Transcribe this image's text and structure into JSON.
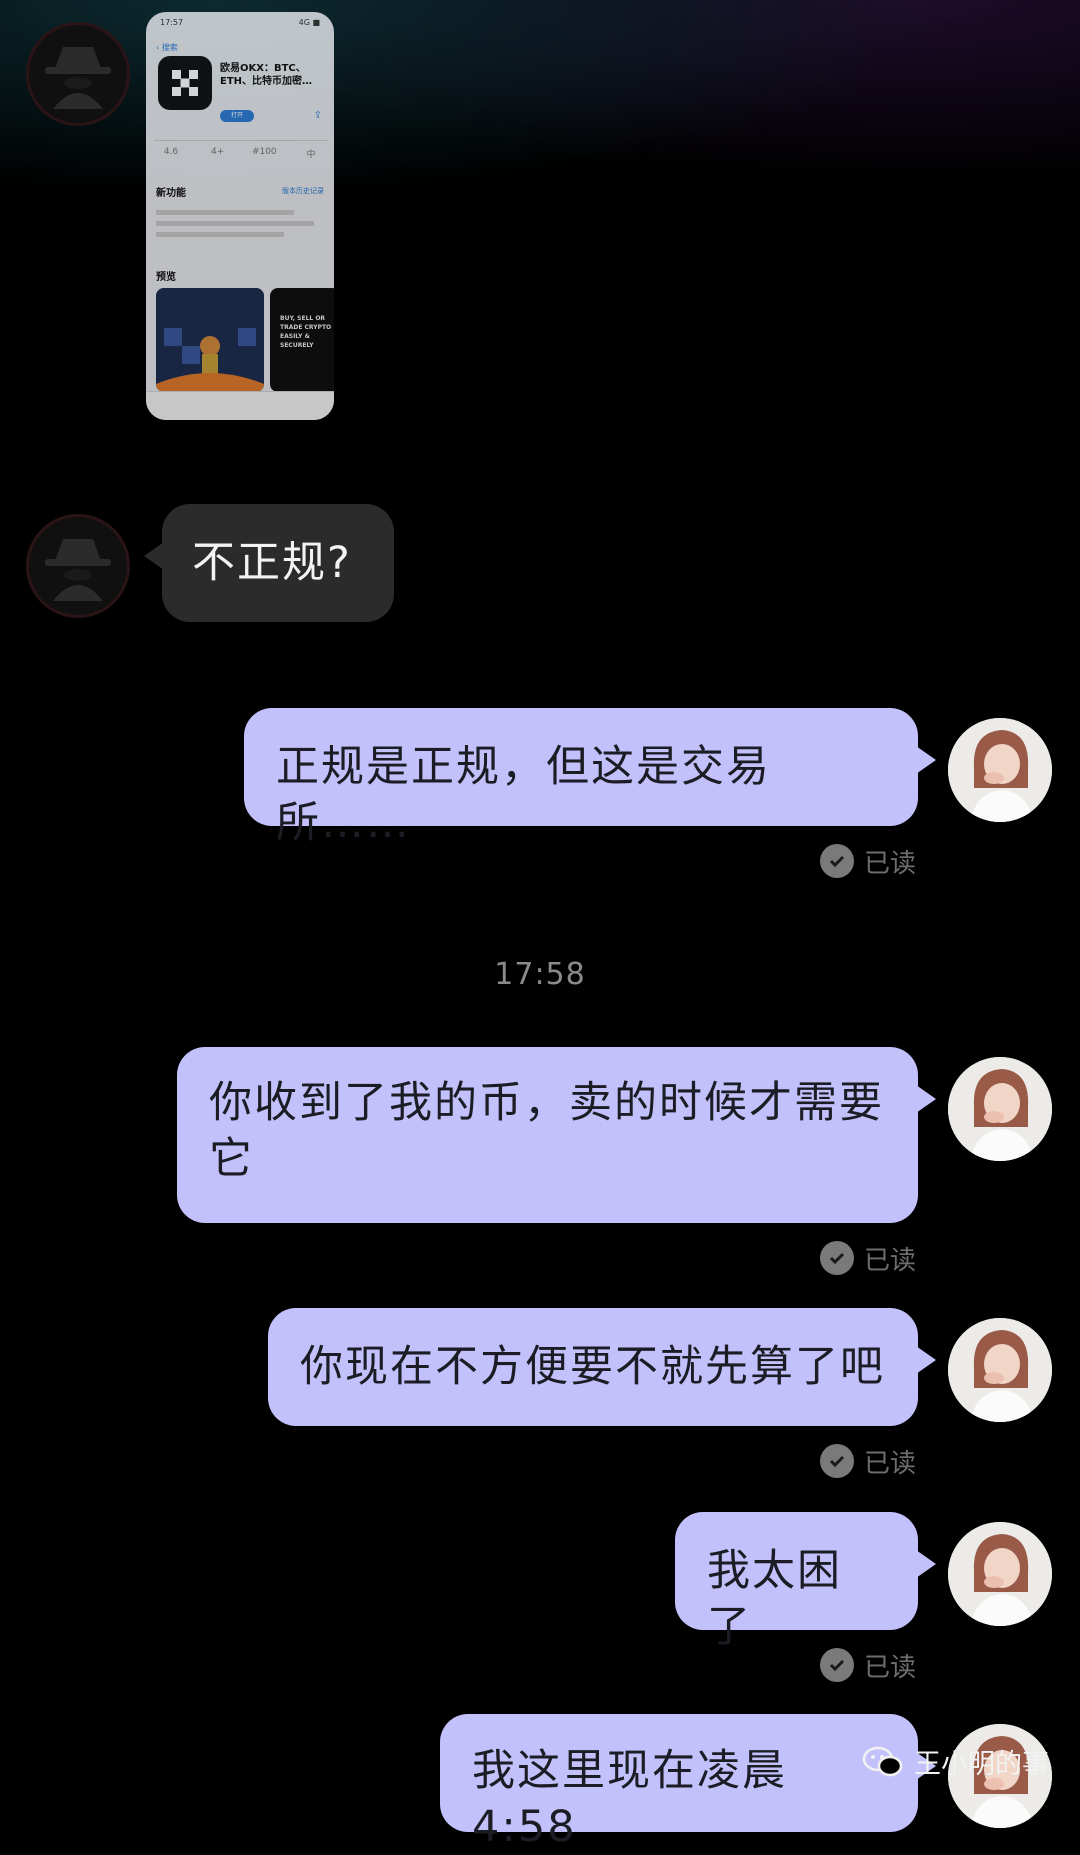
{
  "shared_screenshot": {
    "status_time": "17:57",
    "status_right": "4G ■",
    "back_label": "搜索",
    "app_name": "欧易OKX：BTC、ETH、比特币加密…",
    "get_button": "打开",
    "stats": [
      "4.6",
      "4+",
      "#100",
      "中"
    ],
    "section_new": "新功能",
    "section_new_link": "版本历史记录",
    "section_preview": "预览",
    "preview_text": "BUY, SELL OR TRADE CRYPTO EASILY & SECURELY"
  },
  "messages": [
    {
      "side": "in",
      "text": "不正规?"
    },
    {
      "side": "out",
      "text": "正规是正规，但这是交易所……",
      "status": "已读"
    },
    {
      "side": "out",
      "text": "你收到了我的币，卖的时候才需要它",
      "status": "已读"
    },
    {
      "side": "out",
      "text": "你现在不方便要不就先算了吧",
      "status": "已读"
    },
    {
      "side": "out",
      "text": "我太困了",
      "status": "已读"
    },
    {
      "side": "out",
      "text": "我这里现在凌晨 4:58"
    }
  ],
  "timestamp": "17:58",
  "watermark": "王小明的事"
}
